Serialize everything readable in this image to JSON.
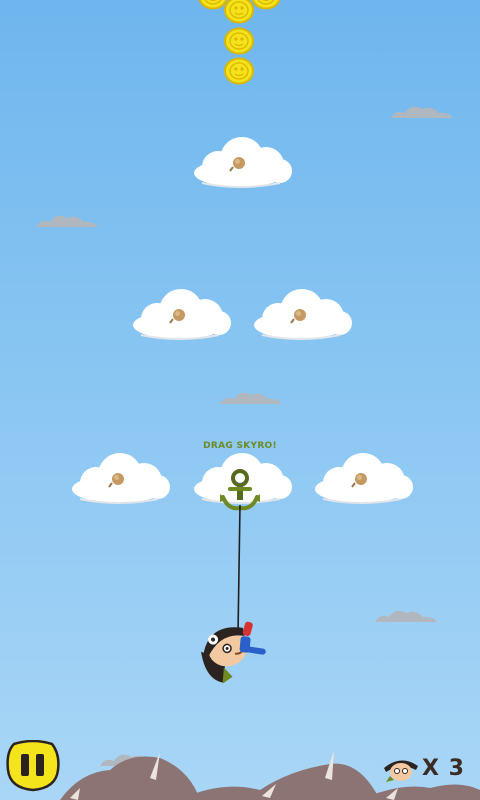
{
  "game": {
    "hint_text": "DRAG SKYRO!",
    "lives_label": "X 3"
  },
  "hud": {
    "pause_icon": "pause-icon",
    "lives_icon": "pirate-head-icon"
  },
  "colors": {
    "sky_top": "#6fb6ee",
    "sky_bottom": "#a9d6f6",
    "coin": "#f5e21a",
    "pause_button": "#f4e41b",
    "hint": "#6d8a2a",
    "mountains": "#8c7474"
  }
}
